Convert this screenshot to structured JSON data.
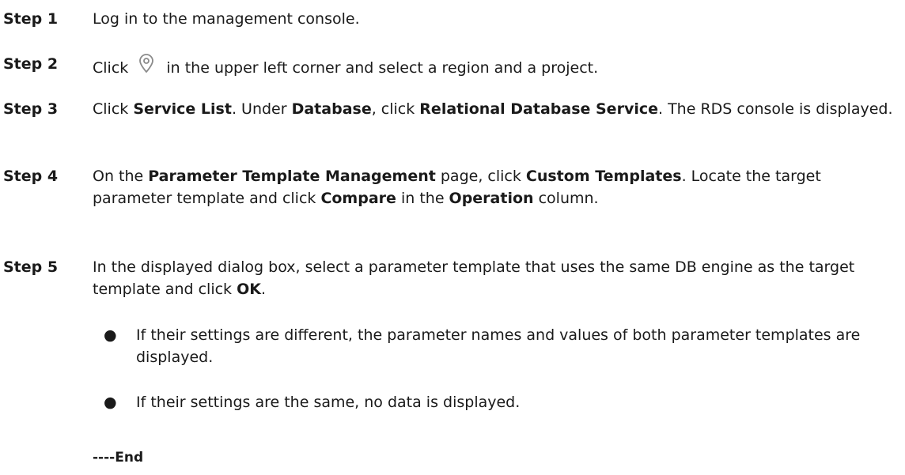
{
  "steps": [
    {
      "label": "Step 1",
      "parts": [
        {
          "t": "Log in to the management console."
        }
      ]
    },
    {
      "label": "Step 2",
      "parts": [
        {
          "t": "Click "
        },
        {
          "icon": "location-pin-icon"
        },
        {
          "t": " in the upper left corner and select a region and a project."
        }
      ]
    },
    {
      "label": "Step 3",
      "parts": [
        {
          "t": "Click "
        },
        {
          "t": "Service List",
          "b": true
        },
        {
          "t": ". Under "
        },
        {
          "t": "Database",
          "b": true
        },
        {
          "t": ", click "
        },
        {
          "t": "Relational Database Service",
          "b": true
        },
        {
          "t": ". The RDS console is displayed."
        }
      ]
    },
    {
      "label": "Step 4",
      "parts": [
        {
          "t": "On the "
        },
        {
          "t": "Parameter Template Management",
          "b": true
        },
        {
          "t": " page, click "
        },
        {
          "t": "Custom Templates",
          "b": true
        },
        {
          "t": ". Locate the target parameter template and click "
        },
        {
          "t": "Compare",
          "b": true
        },
        {
          "t": " in the "
        },
        {
          "t": "Operation",
          "b": true
        },
        {
          "t": " column."
        }
      ]
    },
    {
      "label": "Step 5",
      "parts": [
        {
          "t": "In the displayed dialog box, select a parameter template that uses the same DB engine as the target template and click "
        },
        {
          "t": "OK",
          "b": true
        },
        {
          "t": "."
        }
      ]
    }
  ],
  "bullets": [
    {
      "dot": "●",
      "text": "If their settings are different, the parameter names and values of both parameter templates are displayed."
    },
    {
      "dot": "●",
      "text": "If their settings are the same, no data is displayed."
    }
  ],
  "end_text": "----End",
  "icon_color": "#8a8a8a"
}
